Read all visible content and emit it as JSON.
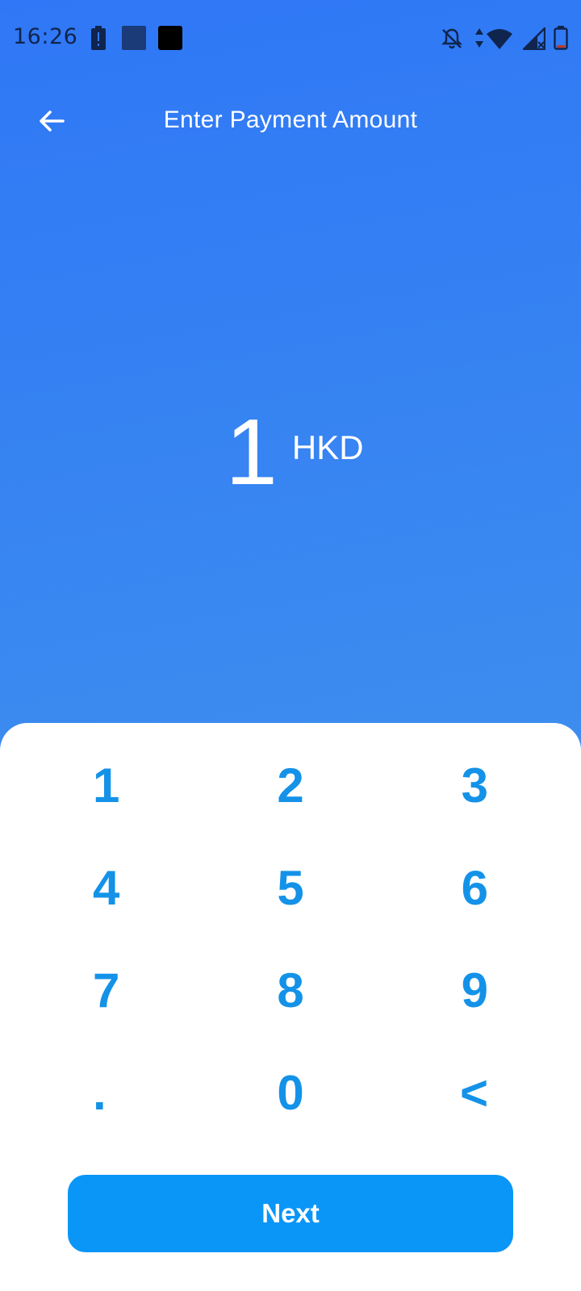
{
  "status_bar": {
    "time": "16:26",
    "icons": [
      "battery-alert-icon",
      "app-notification-icon",
      "app-notification-icon",
      "bell-off-icon",
      "data-arrows-icon",
      "wifi-icon",
      "signal-no-sim-icon",
      "battery-icon"
    ]
  },
  "header": {
    "title": "Enter Payment Amount",
    "back_icon": "arrow-left-icon"
  },
  "amount": {
    "value": "1",
    "currency": "HKD"
  },
  "keypad": {
    "keys": [
      "1",
      "2",
      "3",
      "4",
      "5",
      "6",
      "7",
      "8",
      "9",
      ".",
      "0",
      "<"
    ]
  },
  "actions": {
    "next_label": "Next"
  },
  "colors": {
    "background_top": "#2f77f6",
    "background_bottom": "#4f9ff0",
    "key_text": "#1492e8",
    "next_button": "#0a96f7",
    "sheet": "#ffffff"
  }
}
